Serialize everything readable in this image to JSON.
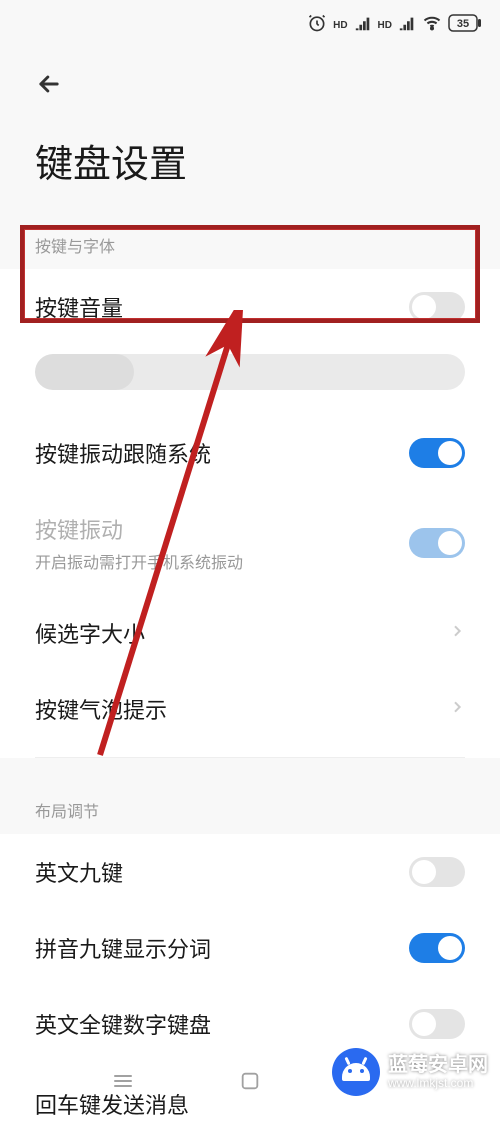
{
  "status": {
    "battery": "35"
  },
  "page": {
    "title": "键盘设置"
  },
  "sections": {
    "keys_font": {
      "header": "按键与字体",
      "volume": {
        "label": "按键音量"
      },
      "vibrate_system": {
        "label": "按键振动跟随系统"
      },
      "vibrate": {
        "label": "按键振动",
        "sub": "开启振动需打开手机系统振动"
      },
      "candidate_size": {
        "label": "候选字大小"
      },
      "bubble_tip": {
        "label": "按键气泡提示"
      }
    },
    "layout": {
      "header": "布局调节",
      "en_nine": {
        "label": "英文九键"
      },
      "pinyin_split": {
        "label": "拼音九键显示分词"
      },
      "en_full_num": {
        "label": "英文全键数字键盘"
      },
      "enter_send": {
        "label": "回车键发送消息"
      }
    }
  },
  "watermark": {
    "title": "蓝莓安卓网",
    "url": "www.lmkjst.com"
  }
}
